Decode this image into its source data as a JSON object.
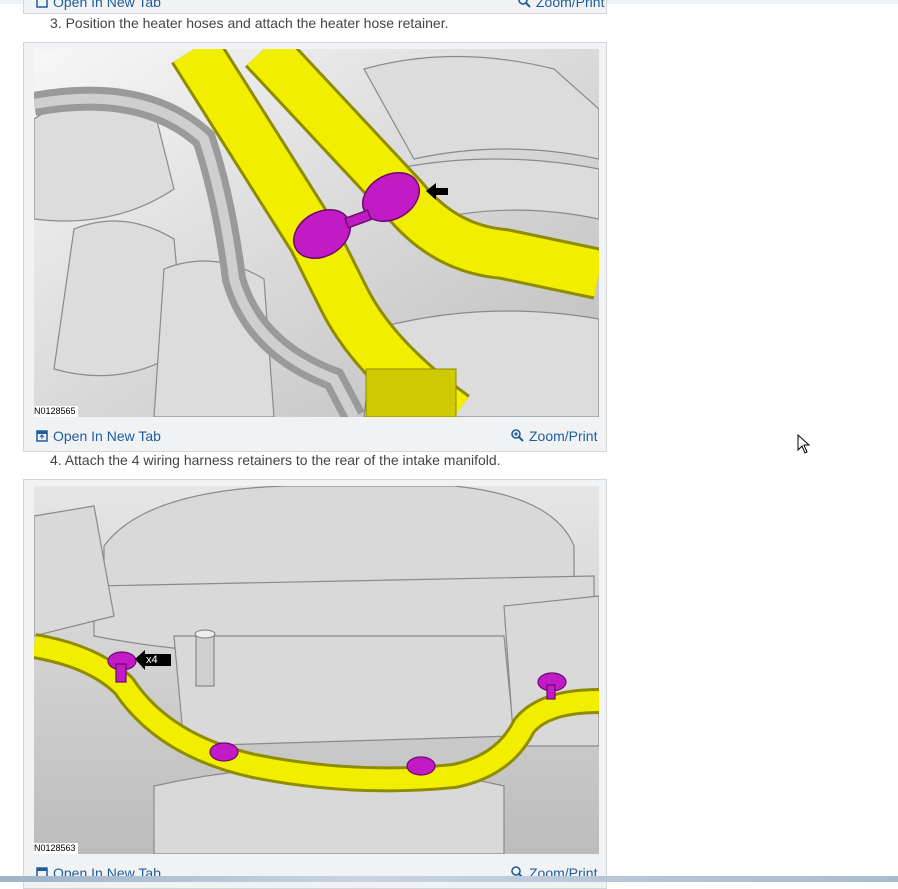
{
  "steps": [
    {
      "text": "3. Position the heater hoses and attach the heater hose retainer."
    },
    {
      "text": "4. Attach the 4 wiring harness retainers to the rear of the intake manifold."
    }
  ],
  "figures": [
    {
      "code": "",
      "open_label": "Open In New Tab",
      "zoom_label": "Zoom/Print"
    },
    {
      "code": "N0128565",
      "open_label": "Open In New Tab",
      "zoom_label": "Zoom/Print"
    },
    {
      "code": "N0128563",
      "open_label": "Open In New Tab",
      "zoom_label": "Zoom/Print",
      "callout": "x4"
    }
  ],
  "colors": {
    "link": "#1f5d9a",
    "highlight_hose": "#f2ee00",
    "retainer": "#c21bc5"
  }
}
